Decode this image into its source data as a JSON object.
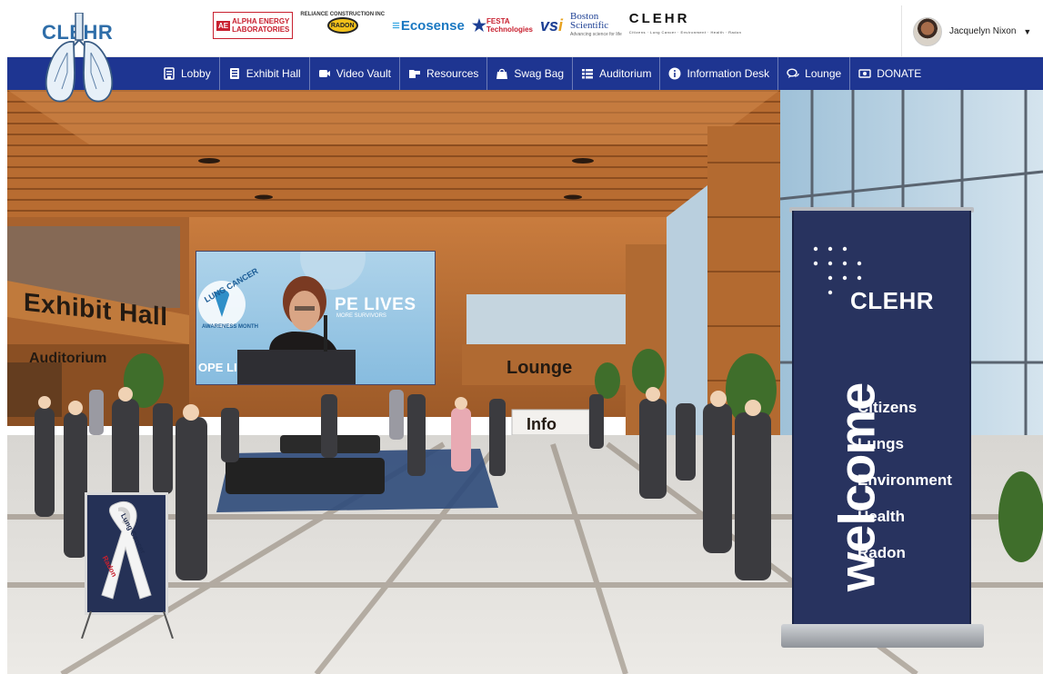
{
  "header": {
    "brand": "CLEHR",
    "sponsors": {
      "alpha_mark": "AE",
      "alpha_line1": "ALPHA ENERGY",
      "alpha_line2": "LABORATORIES",
      "radon_top": "RELIANCE CONSTRUCTION INC",
      "radon_disc": "RADON",
      "ecosense": "Ecosense",
      "festa_line1": "FESTA",
      "festa_line2": "Technologies",
      "vsi_main": "vs",
      "vsi_accent": "i",
      "boston_line1": "Boston",
      "boston_line2": "Scientific",
      "boston_tagline": "Advancing science for life",
      "clehr_logo": "CLEHR",
      "clehr_tagline": "Citizens · Lung Cancer · Environment · Health · Radon"
    },
    "user": {
      "name": "Jacquelyn Nixon",
      "caret": "▼"
    }
  },
  "nav": {
    "items": [
      {
        "label": "Lobby",
        "icon": "lobby-icon"
      },
      {
        "label": "Exhibit Hall",
        "icon": "exhibit-hall-icon"
      },
      {
        "label": "Video Vault",
        "icon": "video-camera-icon"
      },
      {
        "label": "Resources",
        "icon": "folder-icon"
      },
      {
        "label": "Swag Bag",
        "icon": "shopping-bag-icon"
      },
      {
        "label": "Auditorium",
        "icon": "list-icon"
      },
      {
        "label": "Information Desk",
        "icon": "info-icon"
      },
      {
        "label": "Lounge",
        "icon": "chat-bubbles-icon"
      },
      {
        "label": "DONATE",
        "icon": "money-icon"
      }
    ]
  },
  "scene": {
    "signs": {
      "exhibit_hall": "Exhibit Hall",
      "auditorium": "Auditorium",
      "lounge": "Lounge",
      "info": "Info"
    },
    "video_screen": {
      "caption": "PE LIVES",
      "sub": "MORE SURVIVORS",
      "left_text": "OPE LI",
      "ribbon_text": "LUNG CANCER",
      "ribbon_text2": "AWARENESS MONTH"
    },
    "banner": {
      "brand": "CLEHR",
      "welcome": "welcome",
      "items": [
        "Citizens",
        "Lungs",
        "Environment",
        "Health",
        "Radon"
      ]
    },
    "easel": {
      "text": "Lung Cancer",
      "text2": "Radon"
    },
    "colors": {
      "nav_bg": "#1e3591",
      "banner_bg": "#28335f",
      "brand_blue": "#2f6ea9"
    }
  }
}
